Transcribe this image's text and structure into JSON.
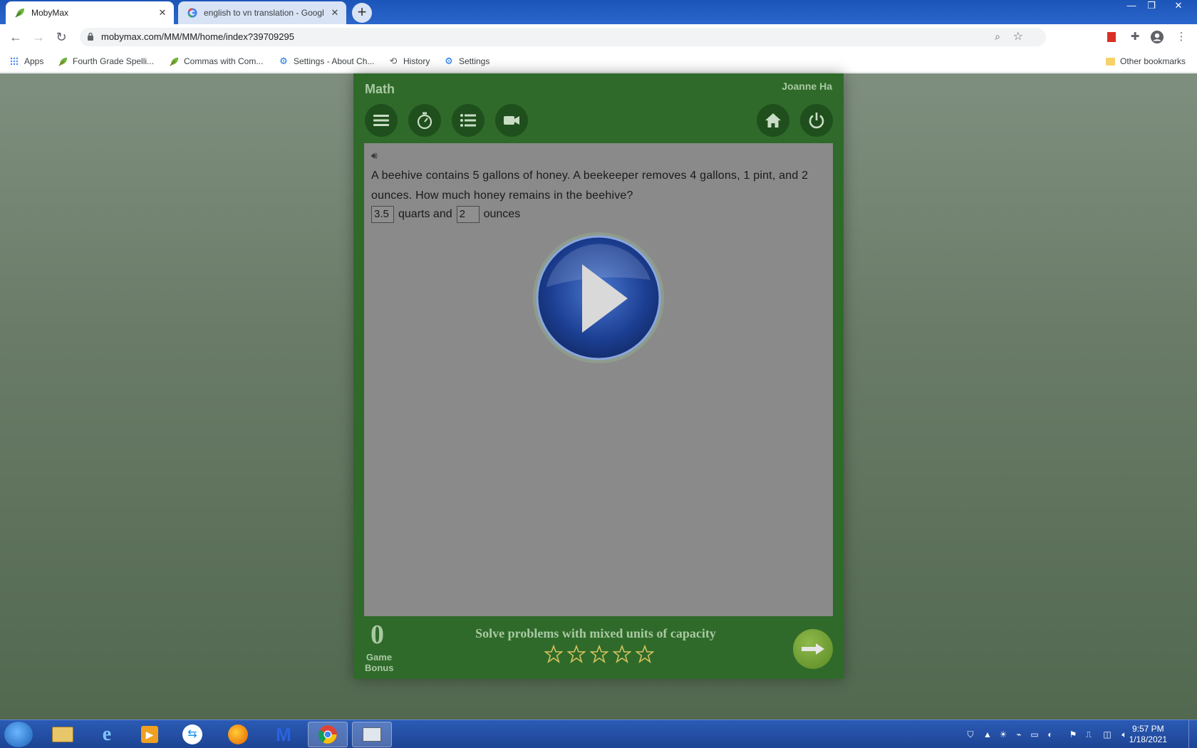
{
  "browser": {
    "tabs": [
      {
        "title": "MobyMax",
        "active": true
      },
      {
        "title": "english to vn translation - Googl",
        "active": false
      }
    ],
    "url": "mobymax.com/MM/MM/home/index?39709295",
    "bookmarks": [
      {
        "label": "Apps",
        "icon": "apps-grid-icon"
      },
      {
        "label": "Fourth Grade Spelli...",
        "icon": "moby-leaf-icon"
      },
      {
        "label": "Commas with Com...",
        "icon": "moby-leaf-icon"
      },
      {
        "label": "Settings - About Ch...",
        "icon": "gear-icon"
      },
      {
        "label": "History",
        "icon": "history-icon"
      },
      {
        "label": "Settings",
        "icon": "gear-icon"
      }
    ],
    "other_bookmarks": "Other bookmarks"
  },
  "app": {
    "subject": "Math",
    "user": "Joanne Ha",
    "question": "A beehive contains 5 gallons of honey. A beekeeper removes 4 gallons, 1 pint, and 2 ounces. How much honey remains in the beehive?",
    "answer": {
      "value1": "3.5",
      "unit1": "quarts and",
      "value2": "2",
      "unit2": "ounces"
    },
    "bonus": {
      "count": "0",
      "label_line1": "Game",
      "label_line2": "Bonus"
    },
    "skill": "Solve problems with mixed units of capacity",
    "stars_earned": 0,
    "stars_total": 5,
    "colors": {
      "panel": "#2f6a2a",
      "accent": "#a9c9a3",
      "content_bg": "#8a8a8a"
    }
  },
  "taskbar": {
    "time": "9:57 PM",
    "date": "1/18/2021"
  }
}
